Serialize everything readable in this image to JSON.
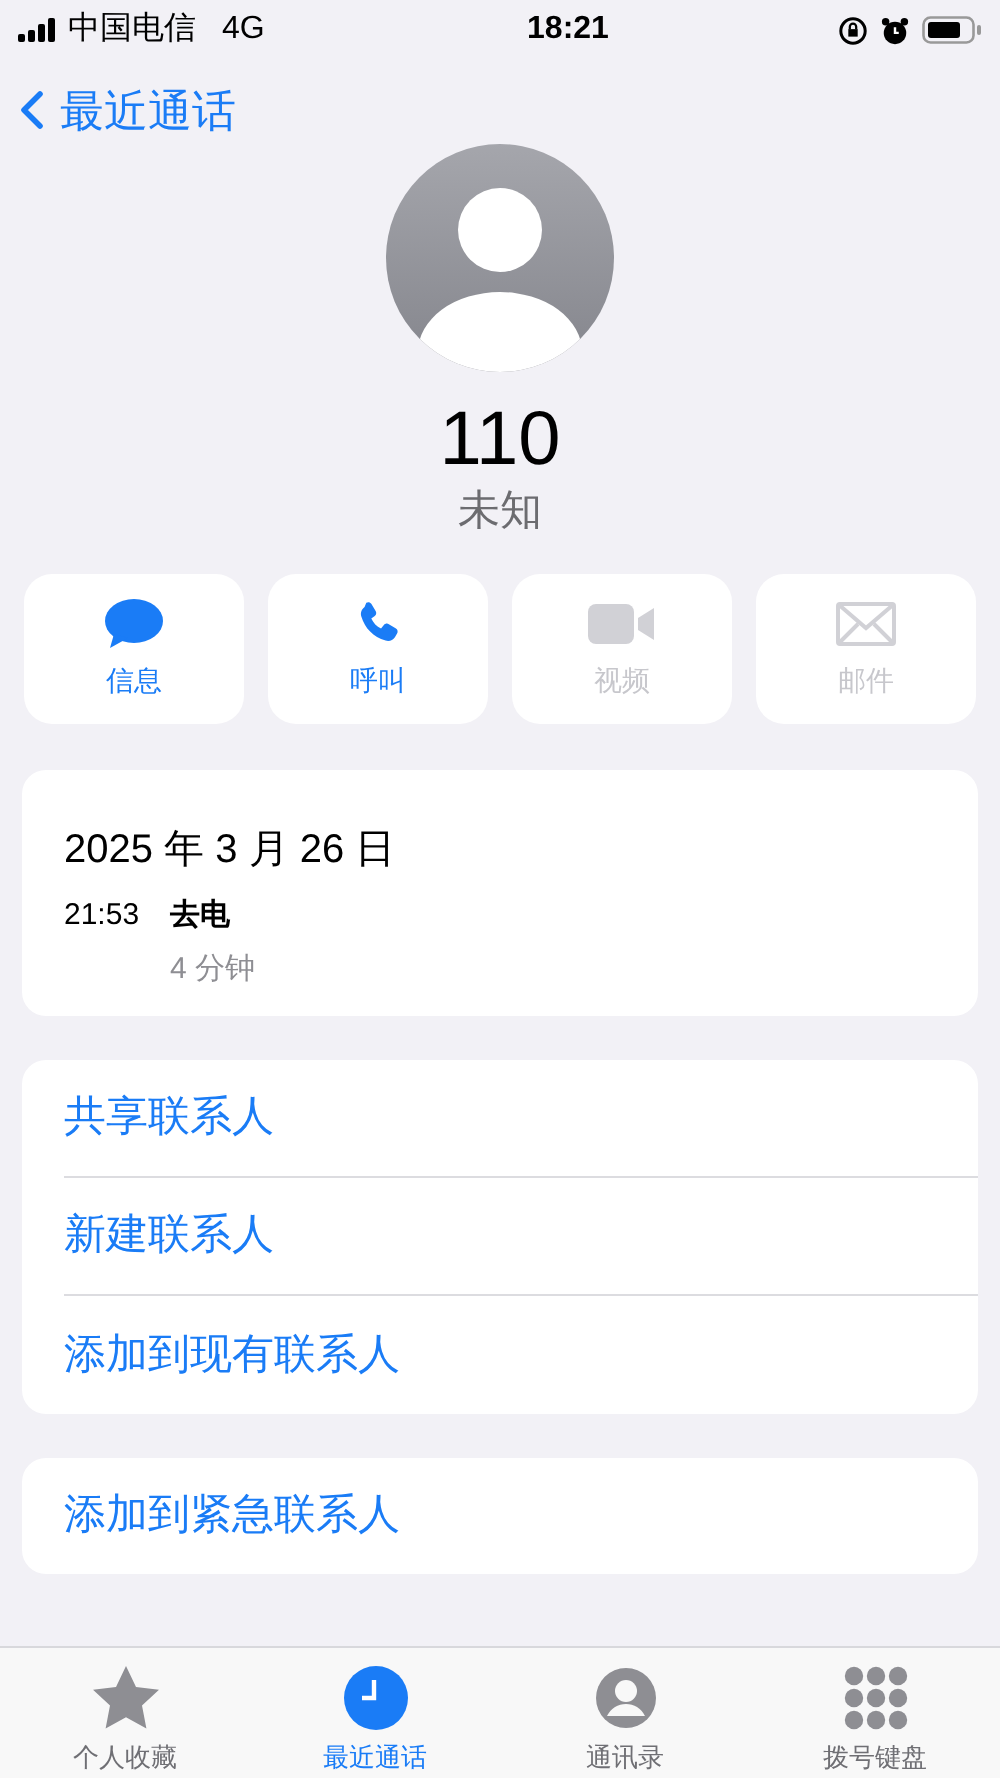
{
  "status_bar": {
    "carrier": "中国电信",
    "network": "4G",
    "time": "18:21"
  },
  "nav": {
    "back_label": "最近通话"
  },
  "contact": {
    "number": "110",
    "label": "未知"
  },
  "actions": [
    {
      "kind": "message",
      "label": "信息",
      "disabled": false
    },
    {
      "kind": "call",
      "label": "呼叫",
      "disabled": false
    },
    {
      "kind": "video",
      "label": "视频",
      "disabled": true
    },
    {
      "kind": "mail",
      "label": "邮件",
      "disabled": true
    }
  ],
  "call_log": {
    "date": "2025 年 3 月 26 日",
    "entries": [
      {
        "time": "21:53",
        "type": "去电",
        "duration": "4 分钟"
      }
    ]
  },
  "options": [
    "共享联系人",
    "新建联系人",
    "添加到现有联系人"
  ],
  "emergency_option": "添加到紧急联系人",
  "tabs": [
    {
      "kind": "favorites",
      "label": "个人收藏",
      "selected": false
    },
    {
      "kind": "recents",
      "label": "最近通话",
      "selected": true
    },
    {
      "kind": "contacts",
      "label": "通讯录",
      "selected": false
    },
    {
      "kind": "keypad",
      "label": "拨号键盘",
      "selected": false
    }
  ]
}
